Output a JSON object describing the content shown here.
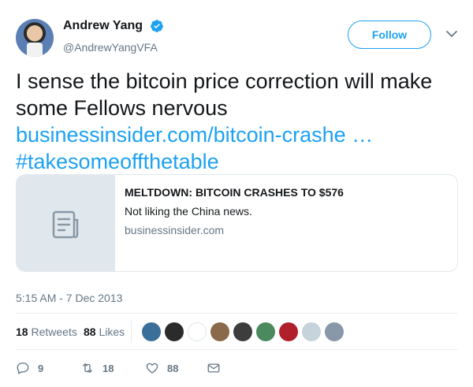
{
  "author": {
    "display_name": "Andrew Yang",
    "handle": "@AndrewYangVFA",
    "verified": true
  },
  "follow_button_label": "Follow",
  "tweet": {
    "text_line1": "I sense the bitcoin price correction will make",
    "text_line2": "some Fellows nervous",
    "link": "businessinsider.com/bitcoin-crashe …",
    "hashtag": "#takesomeoffthetable"
  },
  "card": {
    "title": "MELTDOWN: BITCOIN CRASHES TO $576",
    "description": "Not liking the China news.",
    "domain": "businessinsider.com",
    "thumb_icon": "document-icon"
  },
  "timestamp": "5:15 AM - 7 Dec 2013",
  "stats": {
    "retweets_count": "18",
    "retweets_label": "Retweets",
    "likes_count": "88",
    "likes_label": "Likes"
  },
  "liker_avatars": [
    {
      "color": "#3a6f9a"
    },
    {
      "color": "#2b2b2b"
    },
    {
      "color": "#ffffff"
    },
    {
      "color": "#8a6a4a"
    },
    {
      "color": "#3d3d3d"
    },
    {
      "color": "#4a8a5c"
    },
    {
      "color": "#b0202a"
    },
    {
      "color": "#c7d3da"
    },
    {
      "color": "#8898a8"
    }
  ],
  "actions": {
    "reply_count": "9",
    "retweet_count": "18",
    "like_count": "88"
  },
  "colors": {
    "accent": "#1da1f2",
    "secondary_text": "#657786",
    "border": "#e1e8ed"
  }
}
